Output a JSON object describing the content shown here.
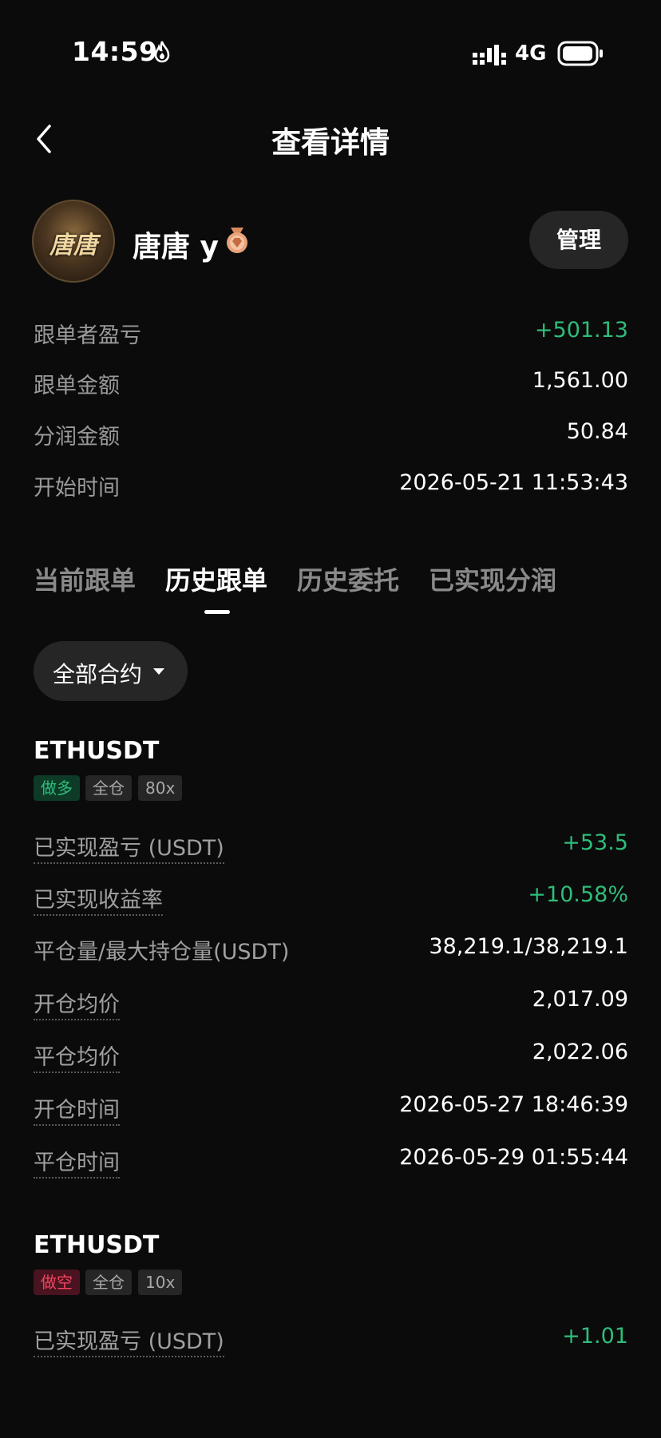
{
  "status_bar": {
    "time": "14:59",
    "network": "4G",
    "icons": [
      "flame-icon",
      "signal-icon",
      "battery-icon"
    ]
  },
  "header": {
    "title": "查看详情",
    "back_icon": "back-chevron-icon"
  },
  "profile": {
    "avatar_text": "唐唐",
    "username": "唐唐 y",
    "badge_icon": "bronze-medal-icon",
    "manage_label": "管理"
  },
  "summary": [
    {
      "label": "跟单者盈亏",
      "value": "+501.13",
      "positive": true
    },
    {
      "label": "跟单金额",
      "value": "1,561.00"
    },
    {
      "label": "分润金额",
      "value": "50.84"
    },
    {
      "label": "开始时间",
      "value": "2026-05-21 11:53:43"
    }
  ],
  "tabs": [
    {
      "label": "当前跟单",
      "active": false
    },
    {
      "label": "历史跟单",
      "active": true
    },
    {
      "label": "历史委托",
      "active": false
    },
    {
      "label": "已实现分润",
      "active": false
    }
  ],
  "filter": {
    "selected": "全部合约"
  },
  "positions": [
    {
      "symbol": "ETHUSDT",
      "tags": [
        "做多",
        "全仓",
        "80x"
      ],
      "rows": [
        {
          "label": "已实现盈亏 (USDT)",
          "value": "+53.5"
        },
        {
          "label": "已实现收益率",
          "value": "+10.58%"
        },
        {
          "label": "平仓量/最大持仓量(USDT)",
          "value": "38,219.1/38,219.1"
        },
        {
          "label": "开仓均价",
          "value": "2,017.09"
        },
        {
          "label": "平仓均价",
          "value": "2,022.06"
        },
        {
          "label": "开仓时间",
          "value": "2026-05-27 18:46:39"
        },
        {
          "label": "平仓时间",
          "value": "2026-05-29 01:55:44"
        }
      ]
    },
    {
      "symbol": "ETHUSDT",
      "tags": [
        "做空",
        "全仓",
        "10x"
      ],
      "rows": [
        {
          "label": "已实现盈亏 (USDT)",
          "value": "+1.01"
        }
      ]
    }
  ],
  "colors": {
    "background": "#0b0b0b",
    "positive": "#2ebd7a",
    "negative": "#f0455f",
    "chip_bg": "#262626"
  }
}
